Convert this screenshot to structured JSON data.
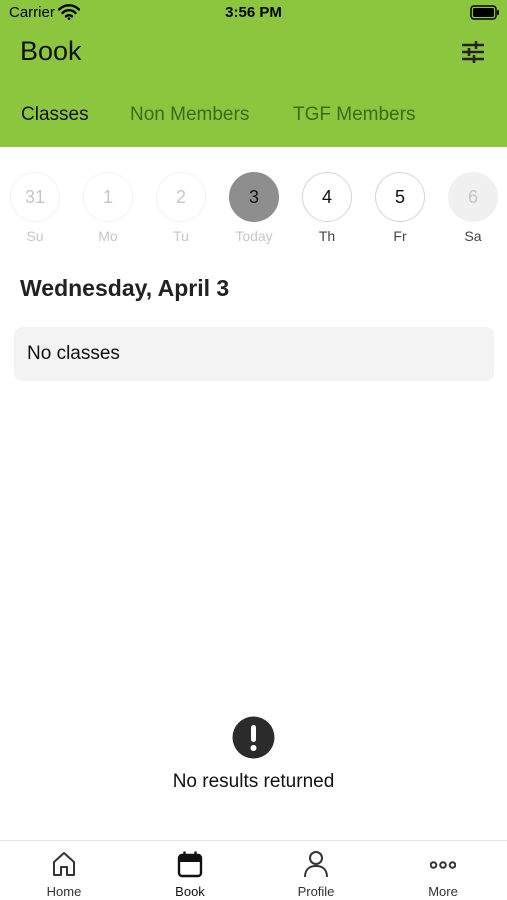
{
  "status_bar": {
    "carrier": "Carrier",
    "time": "3:56 PM"
  },
  "header": {
    "title": "Book",
    "background_color": "#8cc63f"
  },
  "tabs": [
    {
      "label": "Classes",
      "active": true
    },
    {
      "label": "Non Members",
      "active": false
    },
    {
      "label": "TGF Members",
      "active": false
    }
  ],
  "days": [
    {
      "number": "31",
      "label": "Su",
      "state": "past"
    },
    {
      "number": "1",
      "label": "Mo",
      "state": "past"
    },
    {
      "number": "2",
      "label": "Tu",
      "state": "past"
    },
    {
      "number": "3",
      "label": "Today",
      "state": "selected"
    },
    {
      "number": "4",
      "label": "Th",
      "state": "available"
    },
    {
      "number": "5",
      "label": "Fr",
      "state": "available"
    },
    {
      "number": "6",
      "label": "Sa",
      "state": "disabled"
    }
  ],
  "main": {
    "date_heading": "Wednesday, April 3",
    "no_classes_text": "No classes",
    "no_results_text": "No results returned"
  },
  "bottom_nav": [
    {
      "label": "Home",
      "icon": "home-icon",
      "active": false
    },
    {
      "label": "Book",
      "icon": "calendar-icon",
      "active": true
    },
    {
      "label": "Profile",
      "icon": "profile-icon",
      "active": false
    },
    {
      "label": "More",
      "icon": "more-icon",
      "active": false
    }
  ]
}
